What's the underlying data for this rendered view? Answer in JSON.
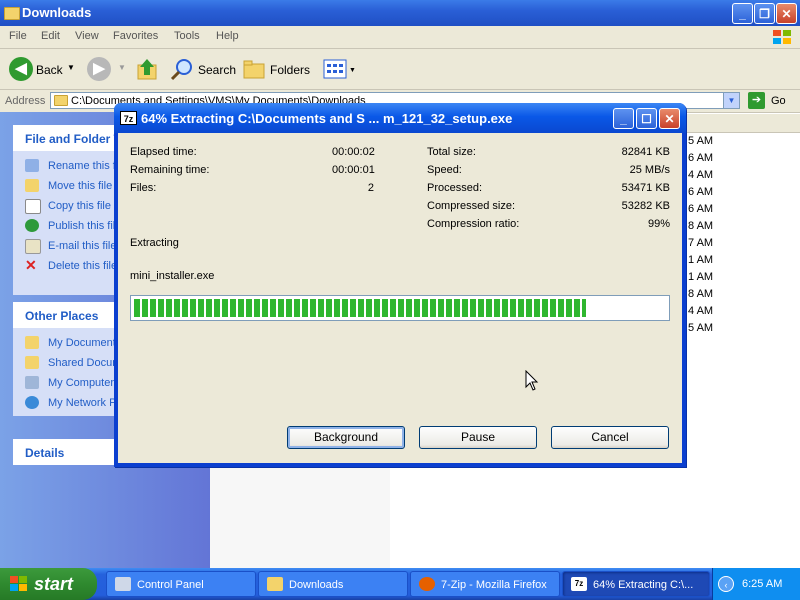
{
  "explorer": {
    "title": "Downloads",
    "menu": [
      "File",
      "Edit",
      "View",
      "Favorites",
      "Tools",
      "Help"
    ],
    "toolbar": {
      "back": "Back",
      "search": "Search",
      "folders": "Folders"
    },
    "address_label": "Address",
    "address_value": "C:\\Documents and Settings\\VMS\\My Documents\\Downloads",
    "go": "Go",
    "file_folder_tasks": {
      "title": "File and Folder T",
      "items": [
        "Rename this fi",
        "Move this file",
        "Copy this file",
        "Publish this file",
        "E-mail this file",
        "Delete this file"
      ]
    },
    "other_places": {
      "title": "Other Places",
      "items": [
        "My Document",
        "Shared Docum",
        "My Computer",
        "My Network P"
      ]
    },
    "details": {
      "title": "Details"
    },
    "times": [
      "5 AM",
      "6 AM",
      "4 AM",
      "6 AM",
      "6 AM",
      "8 AM",
      "7 AM",
      "1 AM",
      "1 AM",
      "8 AM",
      "4 AM",
      "5 AM"
    ]
  },
  "dialog": {
    "icon_text": "7z",
    "title": "64% Extracting C:\\Documents and S ... m_121_32_setup.exe",
    "elapsed_label": "Elapsed time:",
    "elapsed_value": "00:00:02",
    "remaining_label": "Remaining time:",
    "remaining_value": "00:00:01",
    "files_label": "Files:",
    "files_value": "2",
    "total_label": "Total size:",
    "total_value": "82841 KB",
    "speed_label": "Speed:",
    "speed_value": "25 MB/s",
    "processed_label": "Processed:",
    "processed_value": "53471 KB",
    "compressed_label": "Compressed size:",
    "compressed_value": "53282 KB",
    "ratio_label": "Compression ratio:",
    "ratio_value": "99%",
    "status": "Extracting",
    "current_file": "mini_installer.exe",
    "progress": 0.85,
    "buttons": {
      "background": "Background",
      "pause": "Pause",
      "cancel": "Cancel"
    }
  },
  "taskbar": {
    "start": "start",
    "tasks": [
      "Control Panel",
      "Downloads",
      "7-Zip - Mozilla Firefox",
      "64% Extracting C:\\..."
    ],
    "clock": "6:25 AM"
  }
}
